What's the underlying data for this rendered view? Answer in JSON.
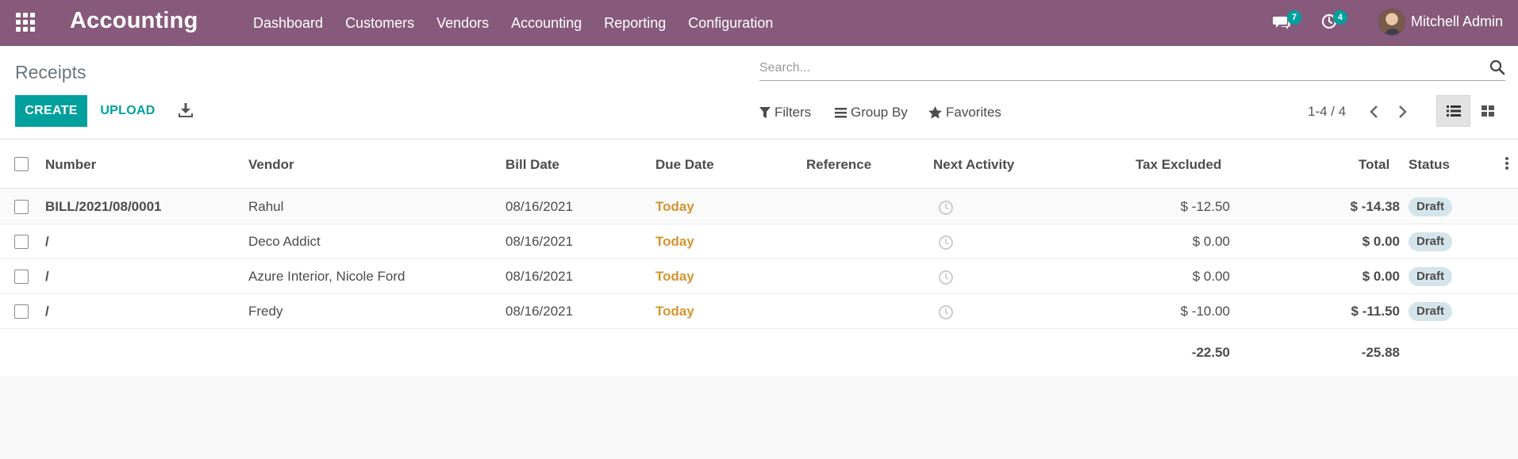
{
  "navbar": {
    "brand": "Accounting",
    "menu": [
      "Dashboard",
      "Customers",
      "Vendors",
      "Accounting",
      "Reporting",
      "Configuration"
    ],
    "messages_count": "7",
    "activities_count": "4",
    "user_name": "Mitchell Admin"
  },
  "control": {
    "title": "Receipts",
    "search_placeholder": "Search...",
    "create_label": "CREATE",
    "upload_label": "UPLOAD",
    "filters_label": "Filters",
    "groupby_label": "Group By",
    "favorites_label": "Favorites",
    "pager": "1-4 / 4"
  },
  "table": {
    "columns": [
      "Number",
      "Vendor",
      "Bill Date",
      "Due Date",
      "Reference",
      "Next Activity",
      "Tax Excluded",
      "Total",
      "Status"
    ],
    "rows": [
      {
        "number": "BILL/2021/08/0001",
        "vendor": "Rahul",
        "bill_date": "08/16/2021",
        "due_date": "Today",
        "reference": "",
        "tax_excluded": "$ -12.50",
        "total": "$ -14.38",
        "status": "Draft"
      },
      {
        "number": "/",
        "vendor": "Deco Addict",
        "bill_date": "08/16/2021",
        "due_date": "Today",
        "reference": "",
        "tax_excluded": "$ 0.00",
        "total": "$ 0.00",
        "status": "Draft"
      },
      {
        "number": "/",
        "vendor": "Azure Interior, Nicole Ford",
        "bill_date": "08/16/2021",
        "due_date": "Today",
        "reference": "",
        "tax_excluded": "$ 0.00",
        "total": "$ 0.00",
        "status": "Draft"
      },
      {
        "number": "/",
        "vendor": "Fredy",
        "bill_date": "08/16/2021",
        "due_date": "Today",
        "reference": "",
        "tax_excluded": "$ -10.00",
        "total": "$ -11.50",
        "status": "Draft"
      }
    ],
    "totals": {
      "tax_excluded": "-22.50",
      "total": "-25.88"
    }
  },
  "colors": {
    "navbar": "#875a7b",
    "primary": "#00a09d",
    "due_today": "#d39430",
    "status_badge": "#d4e4ea"
  },
  "icons": [
    "apps-grid-icon",
    "chat-icon",
    "clock-icon",
    "search-icon",
    "download-icon",
    "filter-icon",
    "list-icon",
    "star-icon",
    "chevron-left-icon",
    "chevron-right-icon",
    "list-view-icon",
    "kanban-view-icon",
    "kebab-icon"
  ]
}
